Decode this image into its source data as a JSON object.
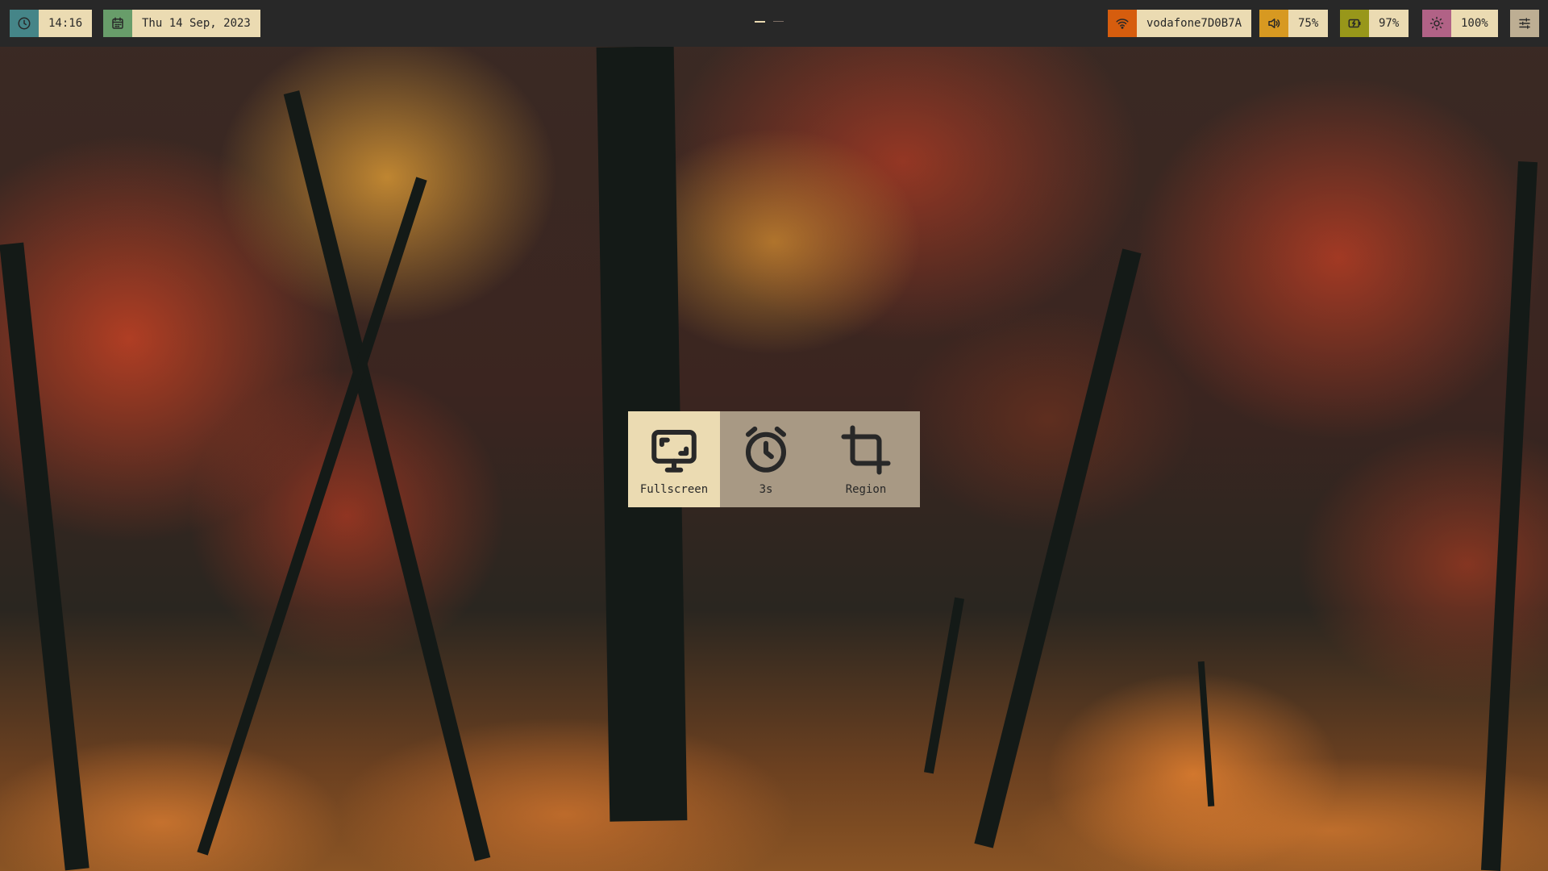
{
  "topbar": {
    "clock": {
      "icon": "clock-icon",
      "time": "14:16",
      "color": "#458588"
    },
    "date": {
      "icon": "calendar-icon",
      "text": "Thu 14 Sep, 2023",
      "color": "#689d6a"
    },
    "workspaces": [
      {
        "active": true
      },
      {
        "active": false
      }
    ],
    "wifi": {
      "icon": "wifi-icon",
      "ssid": "vodafone7D0B7A",
      "color": "#d65d0e"
    },
    "volume": {
      "icon": "speaker-icon",
      "level": "75%",
      "color": "#d79921"
    },
    "battery": {
      "icon": "battery-charging-icon",
      "level": "97%",
      "color": "#98971a"
    },
    "brightness": {
      "icon": "sun-icon",
      "level": "100%",
      "color": "#b16286"
    },
    "settings": {
      "icon": "sliders-icon"
    }
  },
  "screenshot_menu": {
    "options": [
      {
        "label": "Fullscreen",
        "icon": "monitor-icon",
        "selected": true
      },
      {
        "label": "3s",
        "icon": "alarm-clock-icon",
        "selected": false
      },
      {
        "label": "Region",
        "icon": "crop-icon",
        "selected": false
      }
    ]
  }
}
